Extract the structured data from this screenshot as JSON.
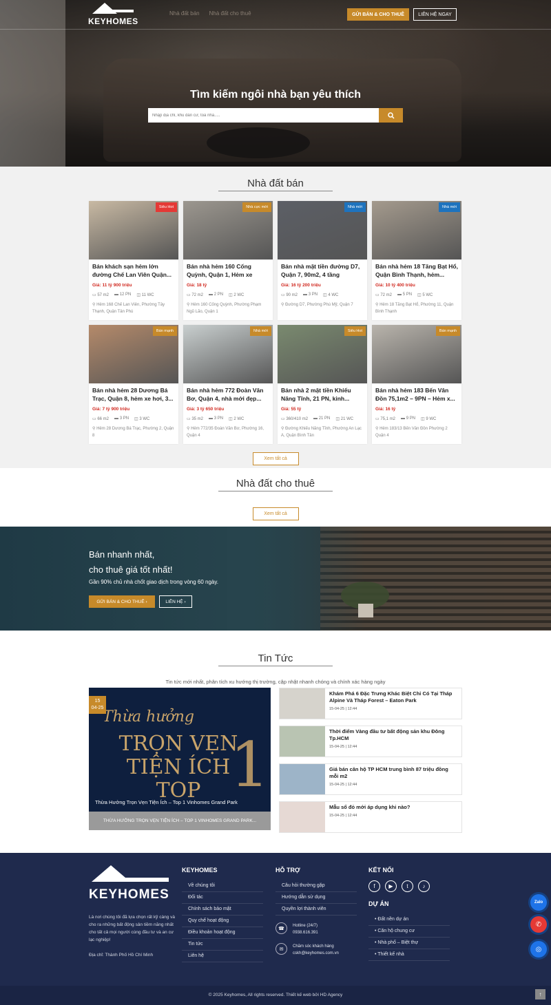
{
  "header": {
    "logo": "KEYHOMES",
    "nav": [
      "Nhà đất bán",
      "Nhà đất cho thuê"
    ],
    "btn_sell": "GỬI BÁN & CHO THUÊ",
    "btn_contact": "LIÊN HỆ NGAY"
  },
  "hero": {
    "title": "Tìm kiếm ngôi nhà bạn yêu thích",
    "placeholder": "Nhập địa chỉ, khu dân cư, toà nhà....."
  },
  "sale": {
    "title": "Nhà đất bán",
    "more": "Xem tất cả",
    "cards": [
      {
        "badge": "Siêu Hot",
        "badge_color": "#e53935",
        "title": "Bán khách sạn hẻm lớn đường Chế Lan Viên Quận...",
        "price": "Giá: 11 tỷ 900 triệu",
        "area": "57 m2",
        "bed": "12 PN",
        "bath": "11 WC",
        "addr": "Hẻm 168 Chế Lan Viên, Phường Tây Thạnh, Quận Tân Phú",
        "img": "#c8b9a3"
      },
      {
        "badge": "Nhà cực mới",
        "badge_color": "#c78a2a",
        "title": "Bán nhà hẻm 160 Cống Quỳnh, Quận 1, Hẻm xe hơi,...",
        "price": "Giá: 18 tỷ",
        "area": "72 m2",
        "bed": "2 PN",
        "bath": "2 WC",
        "addr": "Hẻm 160 Cống Quỳnh, Phường Phạm Ngũ Lão, Quận 1",
        "img": "#9c978f"
      },
      {
        "badge": "Nhà mới",
        "badge_color": "#1e73be",
        "title": "Bán nhà mặt tiền đường D7, Quận 7, 90m2, 4 tầng",
        "price": "Giá: 16 tỷ 200 triệu",
        "area": "90 m2",
        "bed": "3 PN",
        "bath": "4 WC",
        "addr": "Đường D7, Phường Phú Mỹ, Quận 7",
        "img": "#5c5f66"
      },
      {
        "badge": "Nhà mới",
        "badge_color": "#1e73be",
        "title": "Bán nhà hẻm 18 Tăng Bạt Hổ, Quận Bình Thạnh, hẻm...",
        "price": "Giá: 10 tỷ 400 triệu",
        "area": "72 m2",
        "bed": "5 PN",
        "bath": "5 WC",
        "addr": "Hẻm 18 Tăng Bạt Hổ, Phường 11, Quận Bình Thạnh",
        "img": "#a49a8d"
      },
      {
        "badge": "Bán mạnh",
        "badge_color": "#c78a2a",
        "title": "Bán nhà hẻm 28 Dương Bá Trạc, Quận 8, hẻm xe hơi, 3...",
        "price": "Giá: 7 tỷ 900 triệu",
        "area": "66 m2",
        "bed": "3 PN",
        "bath": "3 WC",
        "addr": "Hẻm 28 Dương Bá Trạc, Phường 2, Quận 8",
        "img": "#b58a6a"
      },
      {
        "badge": "Nhà mới",
        "badge_color": "#c78a2a",
        "title": "Bán nhà hẻm 772 Đoàn Văn Bơ, Quận 4, nhà mới đẹp...",
        "price": "Giá: 3 tỷ 650 triệu",
        "area": "35 m2",
        "bed": "3 PN",
        "bath": "2 WC",
        "addr": "Hẻm 772/35 Đoàn Văn Bơ, Phường 16, Quận 4",
        "img": "#c9cfcf"
      },
      {
        "badge": "Siêu Hot",
        "badge_color": "#c78a2a",
        "title": "Bán nhà 2 mặt tiền Khiếu Năng Tĩnh, 21 PN, kinh...",
        "price": "Giá: 55 tỷ",
        "area": "360/410 m2",
        "bed": "21 PN",
        "bath": "21 WC",
        "addr": "Đường Khiếu Năng Tĩnh, Phường An Lạc A, Quận Bình Tân",
        "img": "#7a8a6f"
      },
      {
        "badge": "Bán mạnh",
        "badge_color": "#c78a2a",
        "title": "Bán nhà hẻm 183 Bến Vân Đồn 75,1m2 – 9PN – Hẻm x...",
        "price": "Giá: 16 tỷ",
        "area": "75,1 m2",
        "bed": "9 PN",
        "bath": "9 WC",
        "addr": "Hẻm 183/13 Bến Vân Đồn Phường 2 Quận 4",
        "img": "#b9b4ac"
      }
    ]
  },
  "rent": {
    "title": "Nhà đất cho thuê",
    "more": "Xem tất cả"
  },
  "cta": {
    "line1": "Bán nhanh nhất,",
    "line2": "cho thuê giá tốt nhất!",
    "desc": "Gần 90% chủ nhà chốt giao dịch trong vòng 60 ngày.",
    "btn1": "GỬI BÁN & CHO THUÊ ›",
    "btn2": "LIÊN HỆ ›"
  },
  "news": {
    "title": "Tin Tức",
    "subtitle": "Tin tức mới nhất, phân tích xu hướng thị trường, cập nhật nhanh chóng và chính xác hàng ngày",
    "featured": {
      "day": "15",
      "month": "04-25",
      "script": "Thừa hưởng",
      "big": "TRỌN VẸN TIỆN ÍCH TOP",
      "number": "1",
      "title": "Thừa Hưởng Trọn Vẹn Tiện Ích – Top 1 Vinhomes Grand Park",
      "bar": "THỪA HƯỞNG TRỌN VẸN TIỆN ÍCH – TOP 1 VINHOMES GRAND PARK..."
    },
    "items": [
      {
        "title": "Khám Phá 6 Đặc Trưng Khác Biệt Chỉ Có Tại Tháp Alpine Và Tháp Forest – Eaton Park",
        "date": "15-04-25 | 12:44"
      },
      {
        "title": "Thời điểm Vàng đầu tư bất động sản khu Đông Tp.HCM",
        "date": "15-04-25 | 12:44"
      },
      {
        "title": "Giá bán căn hộ TP HCM trung bình 87 triệu đồng mỗi m2",
        "date": "15-04-25 | 12:44"
      },
      {
        "title": "Mẫu sổ đỏ mới áp dụng khi nào?",
        "date": "15-04-25 | 12:44"
      }
    ]
  },
  "footer": {
    "logo": "KEYHOMES",
    "desc": "Là nơi chúng tôi đã lựa chọn rất kỹ càng và cho ra những bất động sản tiềm năng nhất cho tất cả mọi người cùng đầu tư và an cư lạc nghiệp!",
    "addr": "Địa chỉ: Thành Phố Hồ Chí Minh",
    "col1_title": "KEYHOMES",
    "col1": [
      "Về chúng tôi",
      "Đối tác",
      "Chính sách bảo mật",
      "Quy chế hoạt động",
      "Điều khoản hoạt động",
      "Tin tức",
      "Liên hệ"
    ],
    "col2_title": "HỖ TRỢ",
    "col2": [
      "Câu hỏi thường gặp",
      "Hướng dẫn sử dụng",
      "Quyền lợi thành viên"
    ],
    "hotline_label": "Hotline (24/7)",
    "hotline": "0938.616.391",
    "care_label": "Chăm sóc khách hàng",
    "care": "cskh@keyhomes.com.vn",
    "col3_title": "KẾT NỐI",
    "col4_title": "DỰ ÁN",
    "col4": [
      "• Đất nền dự án",
      "• Căn hộ chung cư",
      "• Nhà phố – Biệt thự",
      "• Thiết kế nhà"
    ],
    "zalo": "Zalo",
    "copyright": "© 2025 Keyhomes, All rights reserved.  Thiết kế web bởi HD Agency"
  }
}
